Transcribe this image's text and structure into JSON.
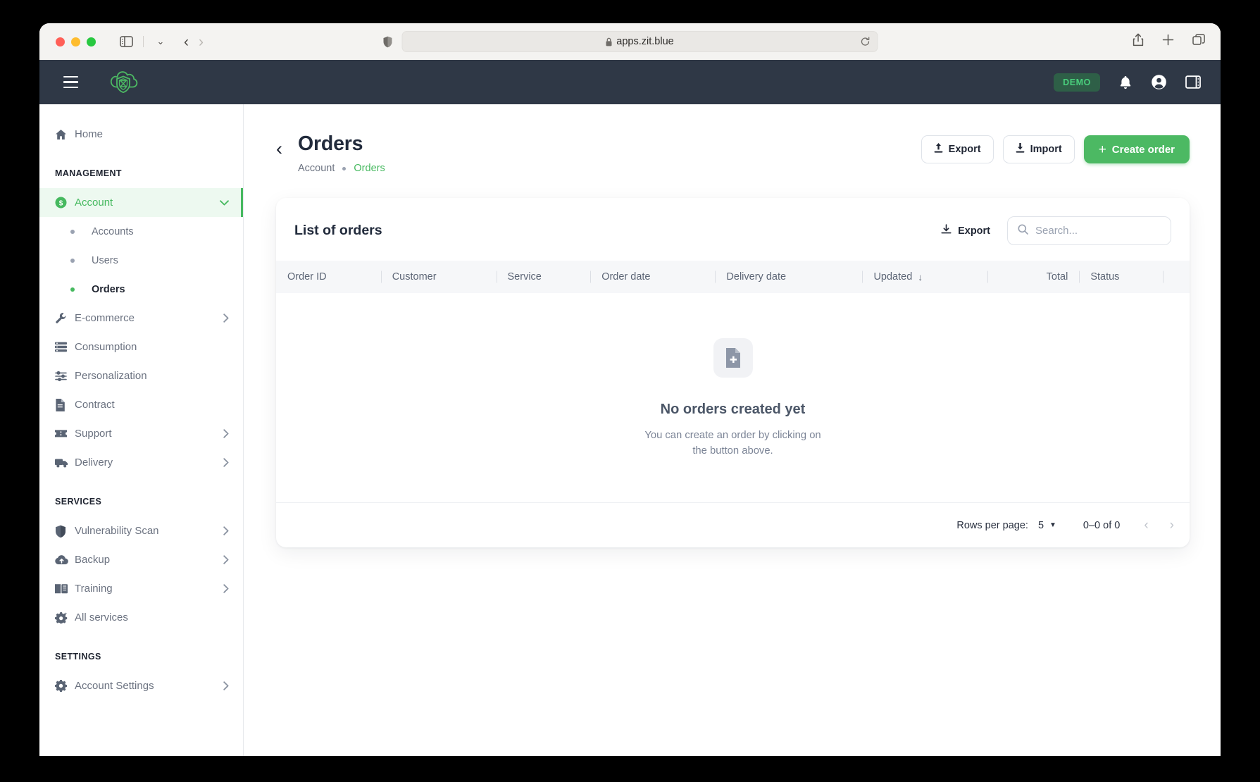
{
  "browser": {
    "url": "apps.zit.blue",
    "lock_icon": "lock-icon",
    "shield_icon": "shield-icon",
    "reload_icon": "reload-icon",
    "sidebar_toggle_icon": "sidebar-toggle-icon",
    "back_icon": "back-arrow-icon",
    "forward_icon": "forward-arrow-icon",
    "share_icon": "share-icon",
    "new_tab_icon": "plus-icon",
    "tabs_icon": "tabs-overview-icon"
  },
  "header": {
    "menu_icon": "hamburger-menu-icon",
    "logo_icon": "cloud-shield-logo",
    "badge": "DEMO",
    "bell_icon": "notifications-bell-icon",
    "account_icon": "account-circle-icon",
    "panel_icon": "right-panel-toggle-icon"
  },
  "sidebar": {
    "home": {
      "label": "Home",
      "icon": "home-icon"
    },
    "sections": [
      {
        "title": "MANAGEMENT",
        "items": [
          {
            "label": "Account",
            "icon": "dollar-circle-icon",
            "active": true,
            "chevron": "chevron-down-icon",
            "children": [
              {
                "label": "Accounts",
                "selected": false
              },
              {
                "label": "Users",
                "selected": false
              },
              {
                "label": "Orders",
                "selected": true
              }
            ]
          },
          {
            "label": "E-commerce",
            "icon": "wrench-icon",
            "chevron": "chevron-right-icon"
          },
          {
            "label": "Consumption",
            "icon": "list-icon",
            "chevron": ""
          },
          {
            "label": "Personalization",
            "icon": "sliders-icon",
            "chevron": ""
          },
          {
            "label": "Contract",
            "icon": "document-icon",
            "chevron": ""
          },
          {
            "label": "Support",
            "icon": "ticket-icon",
            "chevron": "chevron-right-icon"
          },
          {
            "label": "Delivery",
            "icon": "truck-icon",
            "chevron": "chevron-right-icon"
          }
        ]
      },
      {
        "title": "SERVICES",
        "items": [
          {
            "label": "Vulnerability Scan",
            "icon": "shield-icon",
            "chevron": "chevron-right-icon"
          },
          {
            "label": "Backup",
            "icon": "cloud-upload-icon",
            "chevron": "chevron-right-icon"
          },
          {
            "label": "Training",
            "icon": "book-icon",
            "chevron": "chevron-right-icon"
          },
          {
            "label": "All services",
            "icon": "gear-sparkle-icon",
            "chevron": ""
          }
        ]
      },
      {
        "title": "SETTINGS",
        "items": [
          {
            "label": "Account Settings",
            "icon": "gear-icon",
            "chevron": "chevron-right-icon"
          }
        ]
      }
    ]
  },
  "page": {
    "back_icon": "chevron-left-icon",
    "title": "Orders",
    "breadcrumb": {
      "parent": "Account",
      "current": "Orders"
    },
    "actions": {
      "export": {
        "label": "Export",
        "icon": "upload-icon"
      },
      "import": {
        "label": "Import",
        "icon": "download-icon"
      },
      "create": {
        "label": "Create order",
        "icon": "plus-icon"
      }
    }
  },
  "card": {
    "title": "List of orders",
    "export_label": "Export",
    "export_icon": "download-icon",
    "search_placeholder": "Search...",
    "search_value": "",
    "search_icon": "search-icon",
    "columns": [
      {
        "label": "Order ID",
        "align": "left",
        "sorted": false
      },
      {
        "label": "Customer",
        "align": "left",
        "sorted": false
      },
      {
        "label": "Service",
        "align": "left",
        "sorted": false
      },
      {
        "label": "Order date",
        "align": "left",
        "sorted": false
      },
      {
        "label": "Delivery date",
        "align": "left",
        "sorted": false
      },
      {
        "label": "Updated",
        "align": "left",
        "sorted": true,
        "sort_icon": "arrow-down-icon"
      },
      {
        "label": "Total",
        "align": "right",
        "sorted": false
      },
      {
        "label": "Status",
        "align": "left",
        "sorted": false
      }
    ],
    "empty": {
      "icon": "document-plus-icon",
      "title": "No orders created yet",
      "description": "You can create an order by clicking on the button above."
    },
    "footer": {
      "rows_per_page_label": "Rows per page:",
      "rows_per_page_value": "5",
      "caret_icon": "caret-down-icon",
      "range": "0–0 of 0",
      "prev_icon": "chevron-left-icon",
      "next_icon": "chevron-right-icon"
    }
  },
  "colors": {
    "accent_green": "#4cb963",
    "header_navy": "#2f3846",
    "badge_bg": "#2e5f47",
    "badge_text": "#4ad07d"
  }
}
